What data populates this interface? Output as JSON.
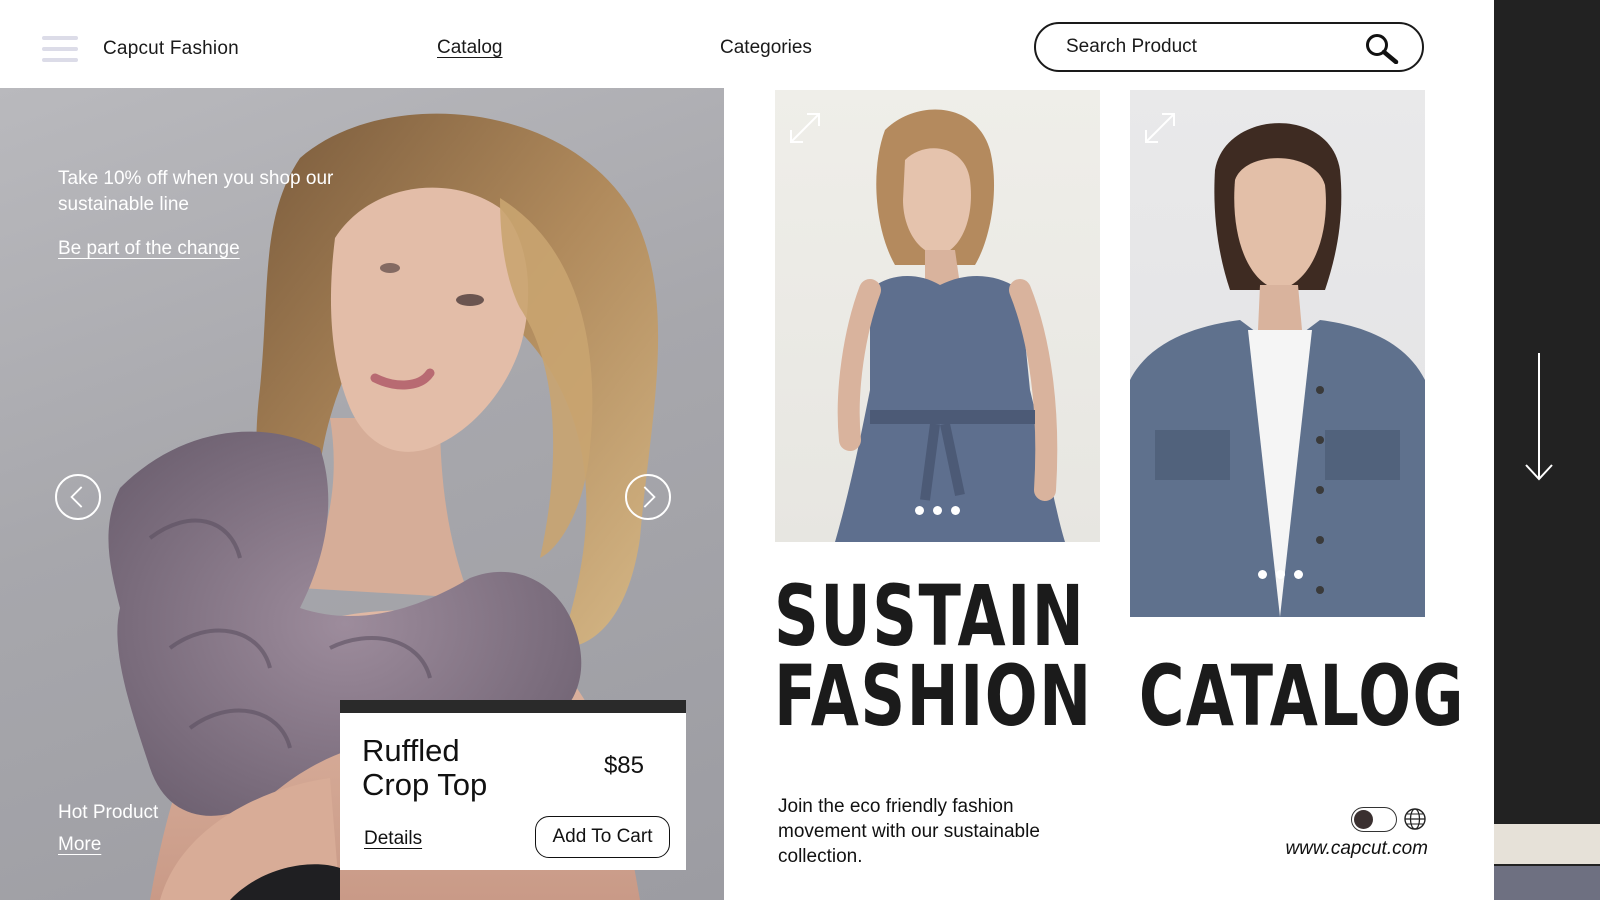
{
  "header": {
    "brand": "Capcut Fashion",
    "nav": {
      "catalog": "Catalog",
      "categories": "Categories"
    },
    "search": {
      "placeholder": "Search Product",
      "value": ""
    }
  },
  "hero": {
    "promo_text": "Take 10% off when you shop our sustainable line",
    "promo_link": "Be part of the change",
    "hot_label": "Hot Product",
    "hot_more": "More"
  },
  "product_card": {
    "name_line1": "Ruffled",
    "name_line2": "Crop Top",
    "price": "$85",
    "details_label": "Details",
    "cart_label": "Add To Cart"
  },
  "headline": {
    "line1": "SUSTAIN",
    "line2": "FASHION  CATALOG"
  },
  "tagline": "Join the eco friendly fashion movement with our sustainable collection.",
  "site_url": "www.capcut.com",
  "colors": {
    "dark": "#222222",
    "swatch_beige": "#e6e1d8",
    "swatch_slate": "#6e7081",
    "hamburger": "#dcdce8"
  },
  "icons": [
    "hamburger-icon",
    "search-icon",
    "chevron-left-icon",
    "chevron-right-icon",
    "expand-icon",
    "toggle-switch",
    "globe-icon",
    "arrow-down-icon"
  ]
}
